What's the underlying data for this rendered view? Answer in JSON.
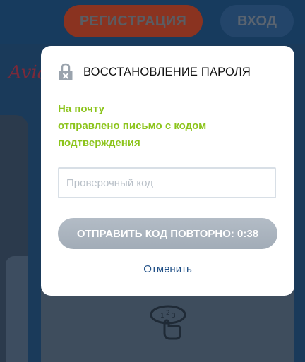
{
  "header": {
    "register_label": "РЕГИСТРАЦИЯ",
    "login_label": "ВХОД"
  },
  "background": {
    "logo_text": "Avia"
  },
  "modal": {
    "title": "ВОССТАНОВЛЕНИЕ ПАРОЛЯ",
    "message_lines": [
      "На почту",
      "отправлено письмо с кодом",
      "подтверждения"
    ],
    "code_input": {
      "placeholder": "Проверочный код",
      "value": ""
    },
    "resend_button_label": "ОТПРАВИТЬ КОД ПОВТОРНО: 0:38",
    "cancel_label": "Отменить"
  },
  "icons": {
    "title_icon": "lock-icon",
    "background_icon": "dial-keypad-icon"
  },
  "colors": {
    "message_green": "#8cc41b",
    "cancel_link_blue": "#1f4f86",
    "resend_button_gray": "#a9b2bd"
  }
}
